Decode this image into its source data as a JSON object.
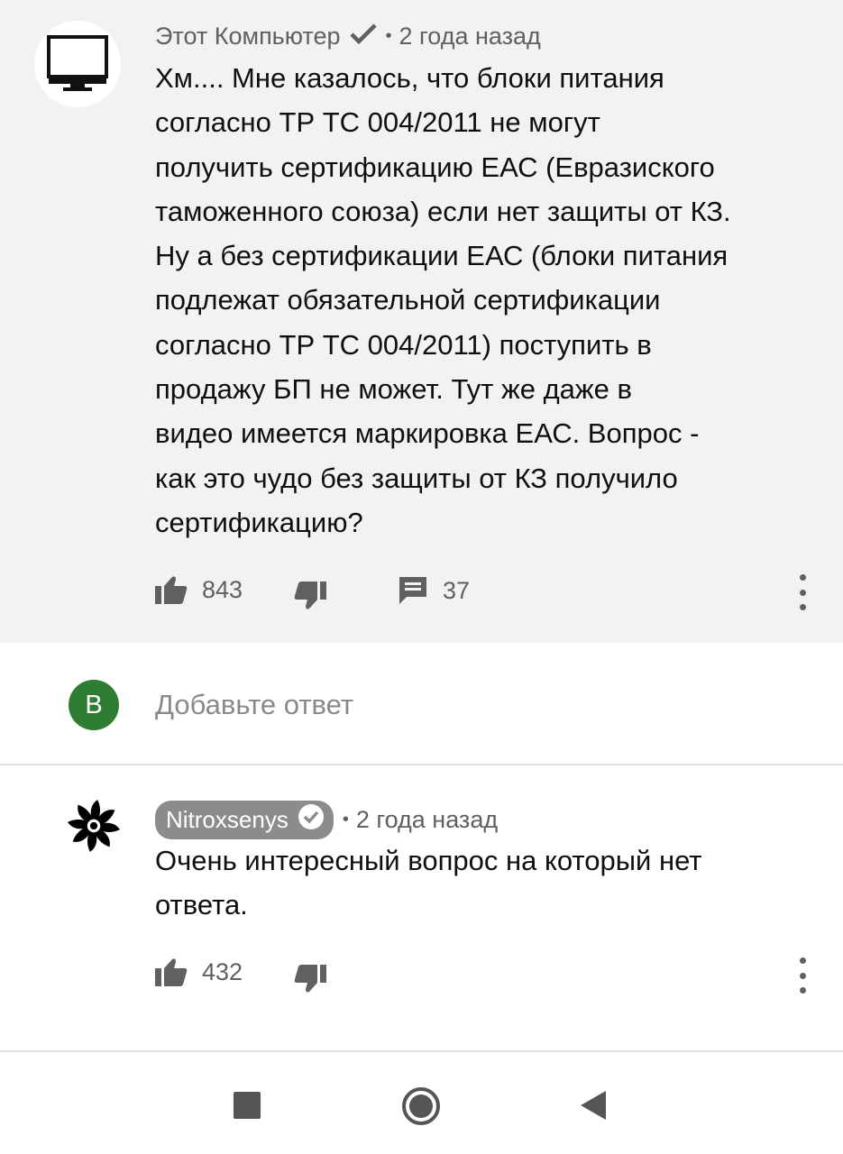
{
  "comment": {
    "author": "Этот Компьютер",
    "time": "2 года назад",
    "separator": "•",
    "text_lines": [
      "Хм.... Мне казалось, что блоки питания",
      "согласно ТР ТС 004/2011 не могут",
      "получить сертификацию ЕАС (Евразиского",
      "таможенного союза) если нет защиты от КЗ.",
      "Ну а без сертификации ЕАС (блоки питания",
      "подлежат обязательной сертификации",
      "согласно ТР ТС 004/2011) поступить в",
      "продажу БП не может. Тут же даже в",
      "видео имеется маркировка ЕАС. Вопрос -",
      "как это чудо без защиты от КЗ получило",
      "сертификацию?"
    ],
    "likes": "843",
    "replies": "37",
    "avatar_icon": "monitor-icon"
  },
  "reply_box": {
    "avatar_letter": "В",
    "avatar_color": "#2e7d32",
    "placeholder": "Добавьте ответ"
  },
  "reply": {
    "author": "Nitroxsenys",
    "time": "2 года назад",
    "separator": "•",
    "text_lines": [
      "Очень интересный вопрос на который нет",
      "ответа."
    ],
    "likes": "432",
    "avatar_icon": "fan-icon"
  },
  "navbar": {
    "items": [
      "recent-apps",
      "home",
      "back"
    ]
  }
}
